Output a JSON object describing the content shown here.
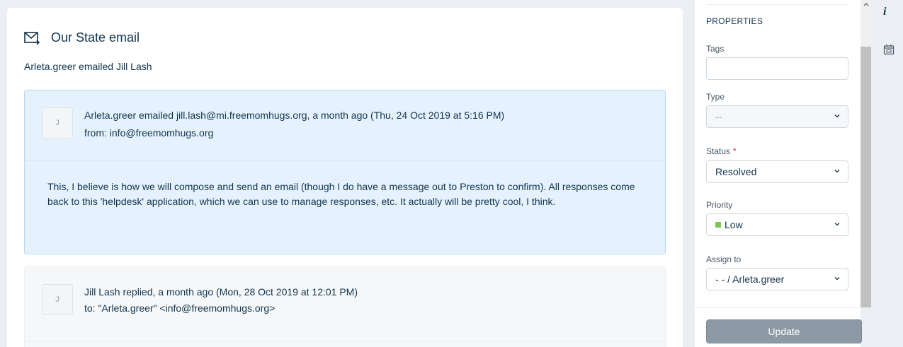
{
  "ticket": {
    "title": "Our State email",
    "subtitle": "Arleta.greer  emailed Jill Lash"
  },
  "threads": [
    {
      "avatar": "J",
      "line1": "Arleta.greer  emailed jill.lash@mi.freemomhugs.org, a month ago (Thu, 24 Oct 2019 at 5:16 PM)",
      "line2": "from: info@freemomhugs.org",
      "body": "This, I believe is how we will compose and send an email (though I do have a message out to Preston to confirm).  All responses come back to this 'helpdesk' application, which we can use to manage responses, etc.  It actually will be pretty cool, I think."
    },
    {
      "avatar": "J",
      "line1": "Jill Lash  replied, a month ago (Mon, 28 Oct 2019 at 12:01 PM)",
      "line2": "to: \"Arleta.greer\" <info@freemomhugs.org>"
    }
  ],
  "properties": {
    "heading": "PROPERTIES",
    "tags_label": "Tags",
    "tags_value": "",
    "type_label": "Type",
    "type_value": "--",
    "status_label": "Status",
    "status_required": "*",
    "status_value": "Resolved",
    "priority_label": "Priority",
    "priority_value": "Low",
    "priority_color": "#7ac74f",
    "assign_label": "Assign to",
    "assign_value": "- - / Arleta.greer",
    "update_label": "Update"
  },
  "rail": {
    "info_glyph": "i",
    "icons": [
      "info-icon",
      "calendar-icon"
    ]
  }
}
